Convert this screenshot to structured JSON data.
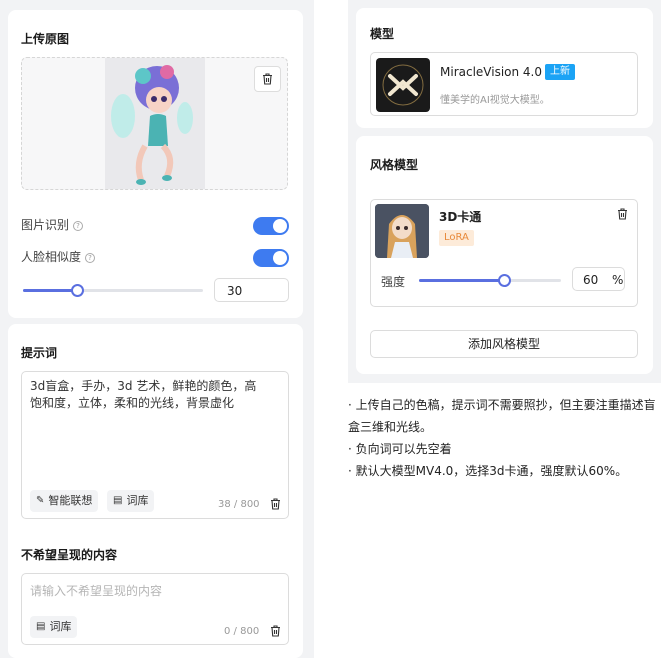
{
  "upload": {
    "title": "上传原图",
    "image_recognition_label": "图片识别",
    "face_similarity_label": "人脸相似度",
    "face_similarity_value": "30",
    "slider_fraction": 0.3
  },
  "prompt": {
    "title": "提示词",
    "text": "3d盲盒，手办，3d 艺术，鲜艳的颜色，高饱和度，立体，柔和的光线，背景虚化",
    "smart_assoc_label": "智能联想",
    "lexicon_label": "词库",
    "counter": "38 / 800"
  },
  "negative": {
    "title": "不希望呈现的内容",
    "placeholder": "请输入不希望呈现的内容",
    "lexicon_label": "词库",
    "counter": "0 / 800"
  },
  "model": {
    "title": "模型",
    "name": "MiracleVision 4.0",
    "badge": "上新",
    "description": "懂美学的AI视觉大模型。"
  },
  "style_model": {
    "title": "风格模型",
    "name": "3D卡通",
    "tag": "LoRA",
    "strength_label": "强度",
    "strength_value": "60",
    "strength_unit": "%",
    "strength_fraction": 0.6,
    "add_button": "添加风格模型"
  },
  "notes": [
    "·  上传自己的色稿，提示词不需要照抄，但主要注重描述盲盒三维和光线。",
    "·  负向词可以先空着",
    "· 默认大模型MV4.0，选择3d卡通，强度默认60%。"
  ],
  "colors": {
    "accent": "#3e7bf0",
    "badge": "#1ba3f5",
    "lora": "#e8893a"
  }
}
